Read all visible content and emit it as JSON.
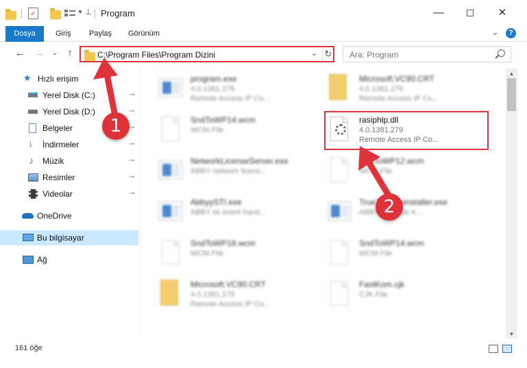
{
  "window": {
    "title": "Program",
    "minimize": "—",
    "maximize": "☐",
    "close": "✕"
  },
  "ribbon": {
    "tabs": [
      "Dosya",
      "Giriş",
      "Paylaş",
      "Görünüm"
    ],
    "expand": "⌄",
    "help": "?"
  },
  "nav": {
    "back": "←",
    "forward": "→",
    "recent": "⌄",
    "up": "↑",
    "address": "C:\\Program Files\\Program Dizini",
    "address_dropdown": "⌄",
    "refresh": "↻",
    "search_placeholder": "Ara: Program"
  },
  "sidebar": {
    "items": [
      {
        "label": "Hızlı erişim",
        "icon": "star-icon",
        "pinned": false
      },
      {
        "label": "Yerel Disk (C:)",
        "icon": "drive-icon",
        "pinned": true
      },
      {
        "label": "Yerel Disk (D:)",
        "icon": "drive-icon",
        "pinned": true
      },
      {
        "label": "Belgeler",
        "icon": "documents-icon",
        "pinned": true
      },
      {
        "label": "İndirmeler",
        "icon": "download-icon",
        "pinned": true
      },
      {
        "label": "Müzik",
        "icon": "music-icon",
        "pinned": true
      },
      {
        "label": "Resimler",
        "icon": "pictures-icon",
        "pinned": true
      },
      {
        "label": "Videolar",
        "icon": "video-icon",
        "pinned": true
      },
      {
        "label": "OneDrive",
        "icon": "cloud-icon",
        "pinned": false
      },
      {
        "label": "Bu bilgisayar",
        "icon": "computer-icon",
        "pinned": false
      },
      {
        "label": "Ağ",
        "icon": "network-icon",
        "pinned": false
      }
    ],
    "pin_glyph": "📌"
  },
  "files": [
    {
      "name": "program.exe",
      "line1": "4.0.1381.279",
      "line2": "Remote Access IP Co...",
      "kind": "exe",
      "blurred": true
    },
    {
      "name": "Microsoft.VC90.CRT",
      "line1": "4.0.1381.279",
      "line2": "Remote Access IP Co...",
      "kind": "crt",
      "blurred": true
    },
    {
      "name": "SndToWP14.wcm",
      "line1": "WCM File",
      "line2": "",
      "kind": "doc",
      "blurred": true
    },
    {
      "name": "rasiphlp.dll",
      "line1": "4.0.1381.279",
      "line2": "Remote Access IP Co...",
      "kind": "dll",
      "blurred": false
    },
    {
      "name": "NetworkLicenseServer.exe",
      "line1": "ABBY network licens...",
      "line2": "",
      "kind": "exe",
      "blurred": true
    },
    {
      "name": "SndToWP12.wcm",
      "line1": "WCM File",
      "line2": "",
      "kind": "doc",
      "blurred": true
    },
    {
      "name": "AbbyySTI.exe",
      "line1": "ABBY sti event hand...",
      "line2": "",
      "kind": "exe",
      "blurred": true
    },
    {
      "name": "TrueTypeUninstaller.exe",
      "line1": "ABBY Remove tr...",
      "line2": "",
      "kind": "exe",
      "blurred": true
    },
    {
      "name": "SndToWP16.wcm",
      "line1": "WCM File",
      "line2": "",
      "kind": "doc",
      "blurred": true
    },
    {
      "name": "SndToWP14.wcm",
      "line1": "WCM File",
      "line2": "",
      "kind": "doc",
      "blurred": true
    },
    {
      "name": "Microsoft.VC90.CRT",
      "line1": "4.0.1381.279",
      "line2": "Remote Access IP Co...",
      "kind": "crt",
      "blurred": true
    },
    {
      "name": "FastKom.cjk",
      "line1": "CJK File",
      "line2": "",
      "kind": "doc",
      "blurred": true
    }
  ],
  "status": {
    "count": "161 öğe"
  },
  "annotations": {
    "step1": "1",
    "step2": "2",
    "color": "#e0323a"
  },
  "colors": {
    "accent": "#1979ca",
    "selection": "#cce8ff",
    "highlight": "#e0323a"
  }
}
